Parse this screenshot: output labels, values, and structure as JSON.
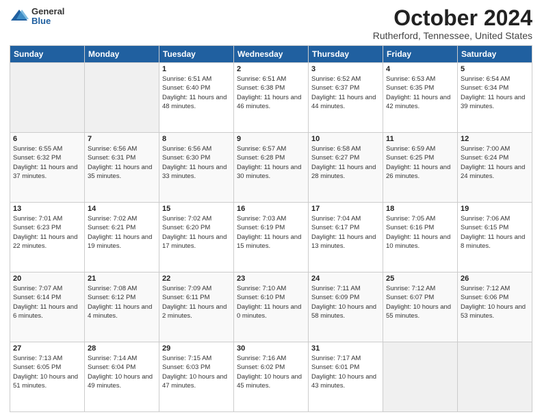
{
  "header": {
    "logo_general": "General",
    "logo_blue": "Blue",
    "month_title": "October 2024",
    "location": "Rutherford, Tennessee, United States"
  },
  "days_of_week": [
    "Sunday",
    "Monday",
    "Tuesday",
    "Wednesday",
    "Thursday",
    "Friday",
    "Saturday"
  ],
  "weeks": [
    [
      {
        "day": "",
        "empty": true
      },
      {
        "day": "",
        "empty": true
      },
      {
        "day": "1",
        "sunrise": "Sunrise: 6:51 AM",
        "sunset": "Sunset: 6:40 PM",
        "daylight": "Daylight: 11 hours and 48 minutes."
      },
      {
        "day": "2",
        "sunrise": "Sunrise: 6:51 AM",
        "sunset": "Sunset: 6:38 PM",
        "daylight": "Daylight: 11 hours and 46 minutes."
      },
      {
        "day": "3",
        "sunrise": "Sunrise: 6:52 AM",
        "sunset": "Sunset: 6:37 PM",
        "daylight": "Daylight: 11 hours and 44 minutes."
      },
      {
        "day": "4",
        "sunrise": "Sunrise: 6:53 AM",
        "sunset": "Sunset: 6:35 PM",
        "daylight": "Daylight: 11 hours and 42 minutes."
      },
      {
        "day": "5",
        "sunrise": "Sunrise: 6:54 AM",
        "sunset": "Sunset: 6:34 PM",
        "daylight": "Daylight: 11 hours and 39 minutes."
      }
    ],
    [
      {
        "day": "6",
        "sunrise": "Sunrise: 6:55 AM",
        "sunset": "Sunset: 6:32 PM",
        "daylight": "Daylight: 11 hours and 37 minutes."
      },
      {
        "day": "7",
        "sunrise": "Sunrise: 6:56 AM",
        "sunset": "Sunset: 6:31 PM",
        "daylight": "Daylight: 11 hours and 35 minutes."
      },
      {
        "day": "8",
        "sunrise": "Sunrise: 6:56 AM",
        "sunset": "Sunset: 6:30 PM",
        "daylight": "Daylight: 11 hours and 33 minutes."
      },
      {
        "day": "9",
        "sunrise": "Sunrise: 6:57 AM",
        "sunset": "Sunset: 6:28 PM",
        "daylight": "Daylight: 11 hours and 30 minutes."
      },
      {
        "day": "10",
        "sunrise": "Sunrise: 6:58 AM",
        "sunset": "Sunset: 6:27 PM",
        "daylight": "Daylight: 11 hours and 28 minutes."
      },
      {
        "day": "11",
        "sunrise": "Sunrise: 6:59 AM",
        "sunset": "Sunset: 6:25 PM",
        "daylight": "Daylight: 11 hours and 26 minutes."
      },
      {
        "day": "12",
        "sunrise": "Sunrise: 7:00 AM",
        "sunset": "Sunset: 6:24 PM",
        "daylight": "Daylight: 11 hours and 24 minutes."
      }
    ],
    [
      {
        "day": "13",
        "sunrise": "Sunrise: 7:01 AM",
        "sunset": "Sunset: 6:23 PM",
        "daylight": "Daylight: 11 hours and 22 minutes."
      },
      {
        "day": "14",
        "sunrise": "Sunrise: 7:02 AM",
        "sunset": "Sunset: 6:21 PM",
        "daylight": "Daylight: 11 hours and 19 minutes."
      },
      {
        "day": "15",
        "sunrise": "Sunrise: 7:02 AM",
        "sunset": "Sunset: 6:20 PM",
        "daylight": "Daylight: 11 hours and 17 minutes."
      },
      {
        "day": "16",
        "sunrise": "Sunrise: 7:03 AM",
        "sunset": "Sunset: 6:19 PM",
        "daylight": "Daylight: 11 hours and 15 minutes."
      },
      {
        "day": "17",
        "sunrise": "Sunrise: 7:04 AM",
        "sunset": "Sunset: 6:17 PM",
        "daylight": "Daylight: 11 hours and 13 minutes."
      },
      {
        "day": "18",
        "sunrise": "Sunrise: 7:05 AM",
        "sunset": "Sunset: 6:16 PM",
        "daylight": "Daylight: 11 hours and 10 minutes."
      },
      {
        "day": "19",
        "sunrise": "Sunrise: 7:06 AM",
        "sunset": "Sunset: 6:15 PM",
        "daylight": "Daylight: 11 hours and 8 minutes."
      }
    ],
    [
      {
        "day": "20",
        "sunrise": "Sunrise: 7:07 AM",
        "sunset": "Sunset: 6:14 PM",
        "daylight": "Daylight: 11 hours and 6 minutes."
      },
      {
        "day": "21",
        "sunrise": "Sunrise: 7:08 AM",
        "sunset": "Sunset: 6:12 PM",
        "daylight": "Daylight: 11 hours and 4 minutes."
      },
      {
        "day": "22",
        "sunrise": "Sunrise: 7:09 AM",
        "sunset": "Sunset: 6:11 PM",
        "daylight": "Daylight: 11 hours and 2 minutes."
      },
      {
        "day": "23",
        "sunrise": "Sunrise: 7:10 AM",
        "sunset": "Sunset: 6:10 PM",
        "daylight": "Daylight: 11 hours and 0 minutes."
      },
      {
        "day": "24",
        "sunrise": "Sunrise: 7:11 AM",
        "sunset": "Sunset: 6:09 PM",
        "daylight": "Daylight: 10 hours and 58 minutes."
      },
      {
        "day": "25",
        "sunrise": "Sunrise: 7:12 AM",
        "sunset": "Sunset: 6:07 PM",
        "daylight": "Daylight: 10 hours and 55 minutes."
      },
      {
        "day": "26",
        "sunrise": "Sunrise: 7:12 AM",
        "sunset": "Sunset: 6:06 PM",
        "daylight": "Daylight: 10 hours and 53 minutes."
      }
    ],
    [
      {
        "day": "27",
        "sunrise": "Sunrise: 7:13 AM",
        "sunset": "Sunset: 6:05 PM",
        "daylight": "Daylight: 10 hours and 51 minutes."
      },
      {
        "day": "28",
        "sunrise": "Sunrise: 7:14 AM",
        "sunset": "Sunset: 6:04 PM",
        "daylight": "Daylight: 10 hours and 49 minutes."
      },
      {
        "day": "29",
        "sunrise": "Sunrise: 7:15 AM",
        "sunset": "Sunset: 6:03 PM",
        "daylight": "Daylight: 10 hours and 47 minutes."
      },
      {
        "day": "30",
        "sunrise": "Sunrise: 7:16 AM",
        "sunset": "Sunset: 6:02 PM",
        "daylight": "Daylight: 10 hours and 45 minutes."
      },
      {
        "day": "31",
        "sunrise": "Sunrise: 7:17 AM",
        "sunset": "Sunset: 6:01 PM",
        "daylight": "Daylight: 10 hours and 43 minutes."
      },
      {
        "day": "",
        "empty": true
      },
      {
        "day": "",
        "empty": true
      }
    ]
  ]
}
